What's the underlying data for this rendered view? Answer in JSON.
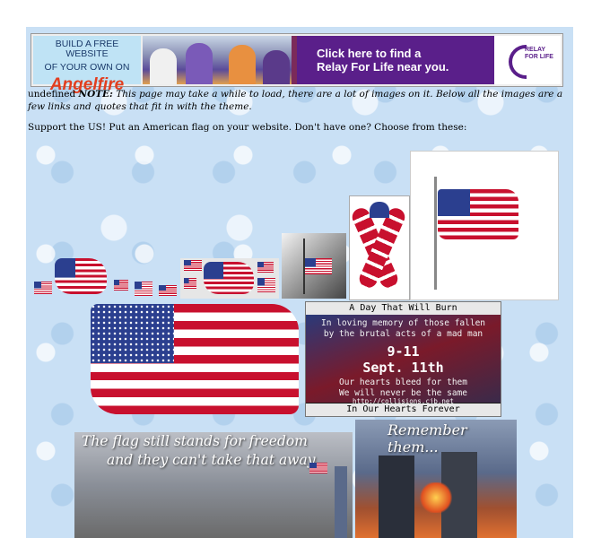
{
  "banner": {
    "angelfire_line1": "BUILD A FREE WEBSITE",
    "angelfire_line2": "OF YOUR OWN ON",
    "angelfire_logo": "Angelfire",
    "relay_line1": "Click here to find a",
    "relay_line2": "Relay For Life near you.",
    "relay_logo_line1": "RELAY",
    "relay_logo_line2": "FOR LIFE"
  },
  "note": {
    "prefix": "undefined ",
    "label": "NOTE:",
    "text": " This page may take a while to load, there are a lot of images on it. Below all the images are a few links and quotes that fit in with the theme."
  },
  "support_text": "Support the US! Put an American flag on your website. Don't have one? Choose from these:",
  "memorial": {
    "top": "A Day That Will Burn",
    "line1": "In loving memory of those fallen",
    "line2": "by the brutal acts of a mad man",
    "date_short": "9-11",
    "date_long": "Sept. 11th",
    "line3": "Our hearts bleed for them",
    "line4": "We will never be the same",
    "url": "http://collisions.cjb.net",
    "bottom": "In Our Hearts Forever"
  },
  "ruins_caption_line1": "The flag still stands for freedom",
  "ruins_caption_line2": "and they can't take that away",
  "towers_caption": "Remember them..."
}
